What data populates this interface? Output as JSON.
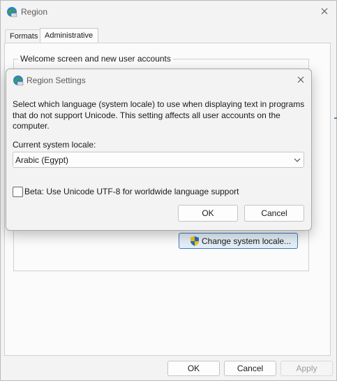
{
  "window": {
    "title": "Region",
    "icon": "globe-icon",
    "close_icon": "close-icon"
  },
  "tabs": [
    {
      "label": "Formats",
      "active": false
    },
    {
      "label": "Administrative",
      "active": true
    }
  ],
  "group": {
    "label": "Welcome screen and new user accounts"
  },
  "change_locale_button": {
    "label": "Change system locale...",
    "icon": "uac-shield-icon"
  },
  "footer": {
    "ok": "OK",
    "cancel": "Cancel",
    "apply": "Apply",
    "apply_enabled": false
  },
  "dialog": {
    "title": "Region Settings",
    "icon": "globe-icon",
    "description": "Select which language (system locale) to use when displaying text in programs that do not support Unicode. This setting affects all user accounts on the computer.",
    "current_label": "Current system locale:",
    "current_value": "Arabic (Egypt)",
    "beta_label": "Beta: Use Unicode UTF-8 for worldwide language support",
    "beta_checked": false,
    "ok": "OK",
    "cancel": "Cancel"
  },
  "colors": {
    "accent": "#3b7bbf",
    "window_bg": "#f3f3f3"
  }
}
